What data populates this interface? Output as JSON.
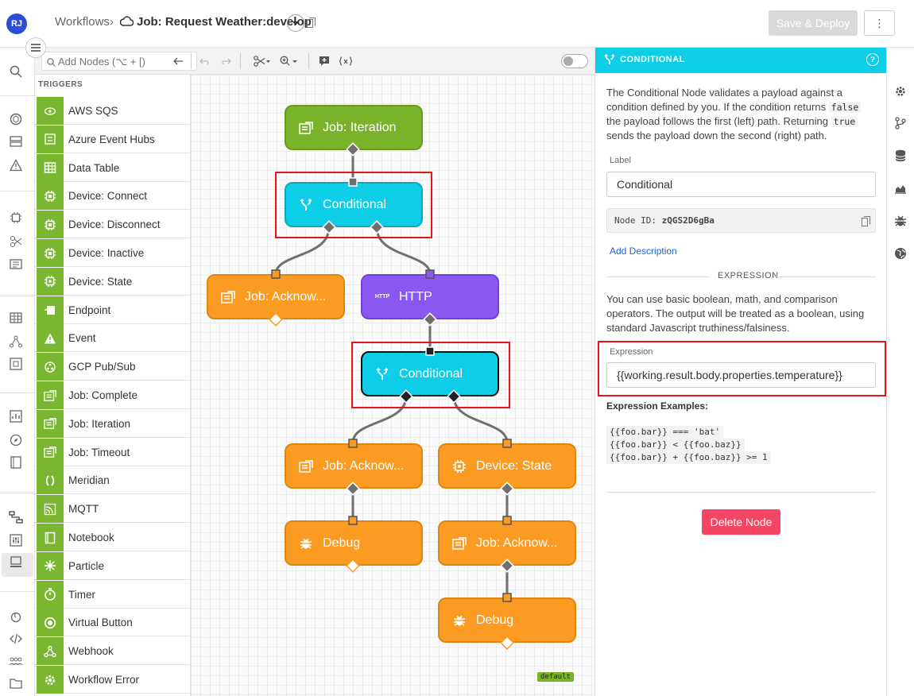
{
  "user": {
    "initials": "RJ"
  },
  "breadcrumb": {
    "root": "Workflows",
    "separator": "›",
    "title": "Job: Request Weather:develop"
  },
  "header": {
    "save_label": "Save & Deploy",
    "more_label": "⋮"
  },
  "toolbar": {
    "search_placeholder": "Add Nodes (⌥ + [)"
  },
  "palette": {
    "section": "TRIGGERS",
    "items": [
      {
        "label": "AWS SQS",
        "icon": "sqs-icon"
      },
      {
        "label": "Azure Event Hubs",
        "icon": "event-hubs-icon"
      },
      {
        "label": "Data Table",
        "icon": "table-icon"
      },
      {
        "label": "Device: Connect",
        "icon": "chip-icon"
      },
      {
        "label": "Device: Disconnect",
        "icon": "chip-icon"
      },
      {
        "label": "Device: Inactive",
        "icon": "chip-icon"
      },
      {
        "label": "Device: State",
        "icon": "chip-gear-icon"
      },
      {
        "label": "Endpoint",
        "icon": "endpoint-icon"
      },
      {
        "label": "Event",
        "icon": "warning-icon"
      },
      {
        "label": "GCP Pub/Sub",
        "icon": "pubsub-icon"
      },
      {
        "label": "Job: Complete",
        "icon": "job-icon"
      },
      {
        "label": "Job: Iteration",
        "icon": "job-icon"
      },
      {
        "label": "Job: Timeout",
        "icon": "job-icon"
      },
      {
        "label": "Meridian",
        "icon": "meridian-icon"
      },
      {
        "label": "MQTT",
        "icon": "mqtt-icon"
      },
      {
        "label": "Notebook",
        "icon": "notebook-icon"
      },
      {
        "label": "Particle",
        "icon": "particle-icon"
      },
      {
        "label": "Timer",
        "icon": "timer-icon"
      },
      {
        "label": "Virtual Button",
        "icon": "button-icon"
      },
      {
        "label": "Webhook",
        "icon": "webhook-icon"
      },
      {
        "label": "Workflow Error",
        "icon": "gear-icon"
      }
    ]
  },
  "canvas": {
    "nodes": {
      "job_iteration": "Job: Iteration",
      "conditional_1": "Conditional",
      "job_ack_1": "Job: Acknow...",
      "http": "HTTP",
      "http_tag": "HTTP",
      "conditional_2": "Conditional",
      "job_ack_2": "Job: Acknow...",
      "device_state": "Device: State",
      "debug_1": "Debug",
      "job_ack_3": "Job: Acknow...",
      "debug_2": "Debug"
    },
    "badge": "default"
  },
  "panel": {
    "title": "CONDITIONAL",
    "desc_1": "The Conditional Node validates a payload against a condition defined by you. If the condition returns",
    "desc_code_false": "false",
    "desc_2": "the payload follows the first (left) path. Returning",
    "desc_code_true": "true",
    "desc_3": "sends the payload down the second (right) path.",
    "label_title": "Label",
    "label_value": "Conditional",
    "node_id_prefix": "Node ID:",
    "node_id": "zQGS2D6gBa",
    "add_description": "Add Description",
    "section_expression": "EXPRESSION",
    "expr_help": "You can use basic boolean, math, and comparison operators. The output will be treated as a boolean, using standard Javascript truthiness/falsiness.",
    "expr_label": "Expression",
    "expr_value": "{{working.result.body.properties.temperature}}",
    "examples_title": "Expression Examples:",
    "examples": [
      "{{foo.bar}} === 'bat'",
      "{{foo.bar}} < {{foo.baz}}",
      "{{foo.bar}} + {{foo.baz}} >= 1"
    ],
    "delete_label": "Delete Node"
  },
  "colors": {
    "trigger_green": "#7ab730",
    "conditional_cyan": "#0ecde6",
    "output_orange": "#fb9b22",
    "http_purple": "#8a57f0",
    "delete_red": "#f44565",
    "highlight_red": "#e3161c"
  }
}
